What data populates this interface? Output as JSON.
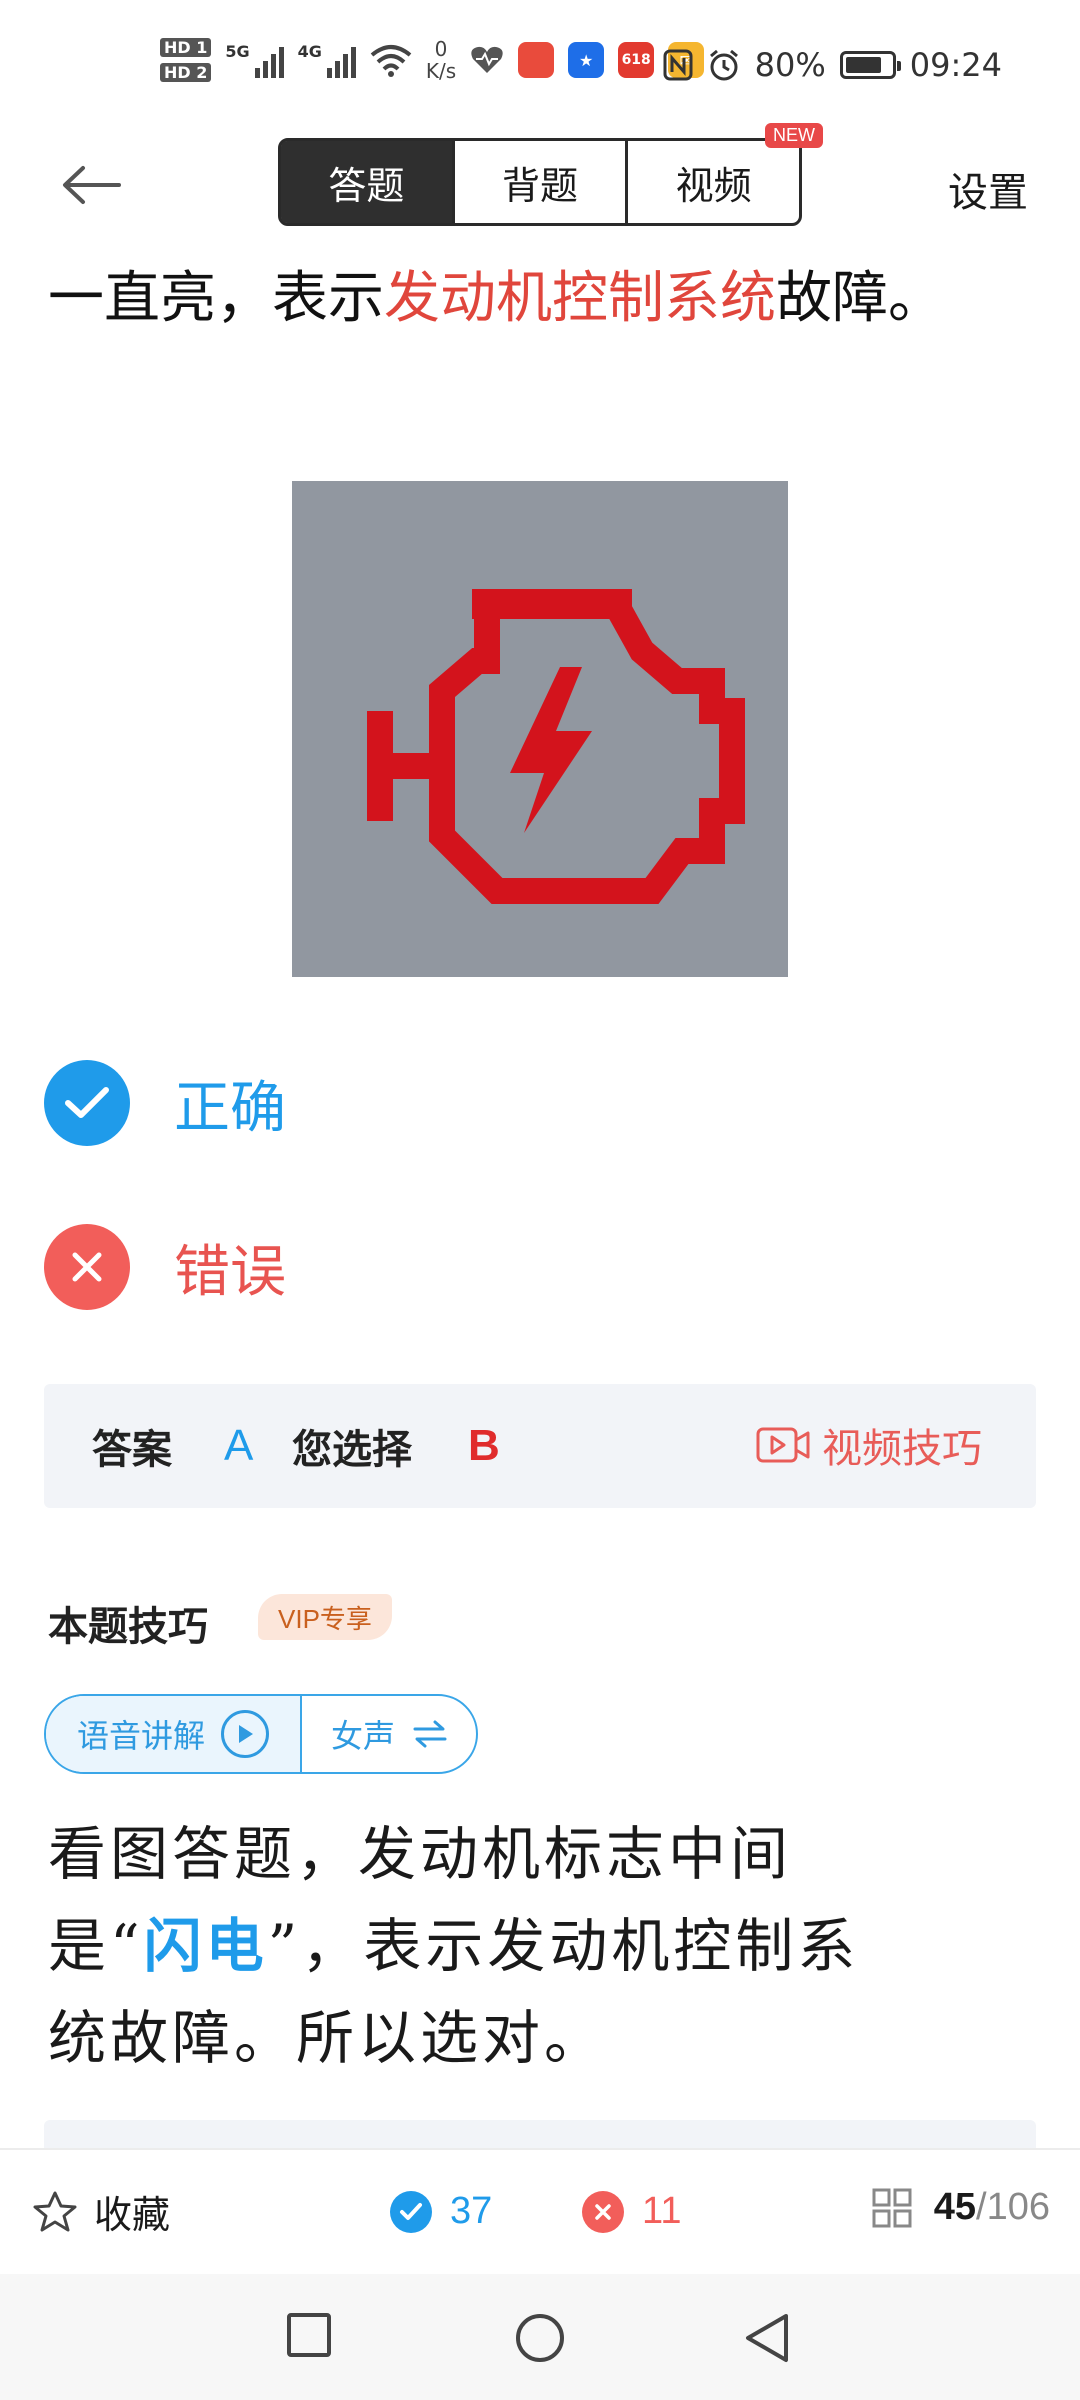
{
  "status_bar": {
    "network_speed_value": "0",
    "network_speed_unit": "K/s",
    "battery": "80%",
    "battery_level": 0.8,
    "time": "09:24",
    "sim1": "HD 1",
    "sim2": "HD 2",
    "sig1_label": "5G",
    "sig2_label": "4G",
    "app_icon_618": "618"
  },
  "nav": {
    "tabs": [
      {
        "label": "答题",
        "active": true
      },
      {
        "label": "背题",
        "active": false
      },
      {
        "label": "视频",
        "active": false
      }
    ],
    "new_badge": "NEW",
    "settings": "设置"
  },
  "question": {
    "text_before": "一直亮，表示",
    "text_highlight": "发动机控制系统",
    "text_after": "故障。",
    "image_icon": "engine-warning-light-icon",
    "image_bg_color": "#9197a0",
    "image_icon_color": "#d3131c"
  },
  "options": {
    "correct_label": "正确",
    "wrong_label": "错误"
  },
  "answer": {
    "answer_label": "答案",
    "answer_value": "A",
    "choice_label": "您选择",
    "choice_value": "B",
    "video_tip": "视频技巧"
  },
  "tips": {
    "title": "本题技巧",
    "vip_badge": "VIP专享",
    "audio_label": "语音讲解",
    "voice_label": "女声",
    "explain_1": "看图答题，发动机标志中间",
    "explain_2a": "是“",
    "explain_2b": "闪电",
    "explain_2c": "”，表示发动机控制系",
    "explain_3": "统故障。所以选对。"
  },
  "bottom_bar": {
    "favorite": "收藏",
    "right_count": "37",
    "wrong_count": "11",
    "current": "45",
    "total": "/106"
  },
  "colors": {
    "accent_blue": "#1f9bea",
    "accent_red": "#f25e5a",
    "highlight_red": "#e0463c"
  }
}
